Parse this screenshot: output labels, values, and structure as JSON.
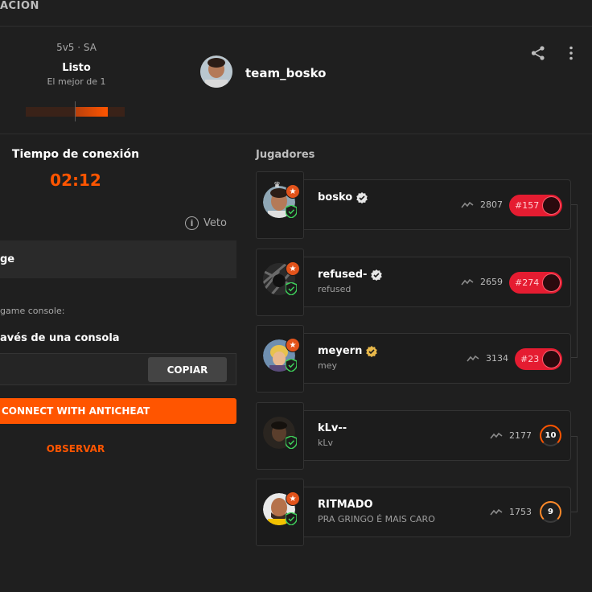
{
  "header": {
    "section_title": "ACIÓN",
    "mode": "5v5 · SA",
    "status": "Listo",
    "best_of": "El mejor de 1",
    "team_name": "team_bosko",
    "progress_fraction": 0.33
  },
  "connection": {
    "title": "Tiempo de conexión",
    "time": "02:12",
    "veto_label": "Veto",
    "map_name": "ge",
    "console_hint": "game console:",
    "console_title": "avés de una consola",
    "command_value": "",
    "copy_label": "COPIAR",
    "connect_label": "CONNECT WITH ANTICHEAT",
    "observe_label": "OBSERVAR"
  },
  "players": {
    "title": "Jugadores",
    "list": [
      {
        "name": "bosko",
        "nick": "",
        "elo": "2807",
        "rank": "#157",
        "level": "",
        "verified": "white"
      },
      {
        "name": "refused-",
        "nick": "refused",
        "elo": "2659",
        "rank": "#274",
        "level": "",
        "verified": "white"
      },
      {
        "name": "meyern",
        "nick": "mey",
        "elo": "3134",
        "rank": "#23",
        "level": "",
        "verified": "gold"
      },
      {
        "name": "kLv--",
        "nick": "kLv",
        "elo": "2177",
        "rank": "",
        "level": "10",
        "verified": ""
      },
      {
        "name": "RITMADO",
        "nick": "PRA GRINGO É MAIS CARO",
        "elo": "1753",
        "rank": "",
        "level": "9",
        "verified": ""
      }
    ]
  },
  "colors": {
    "accent": "#ff5500",
    "rank_red": "#e51c31",
    "shield_green": "#3ecf5a"
  }
}
